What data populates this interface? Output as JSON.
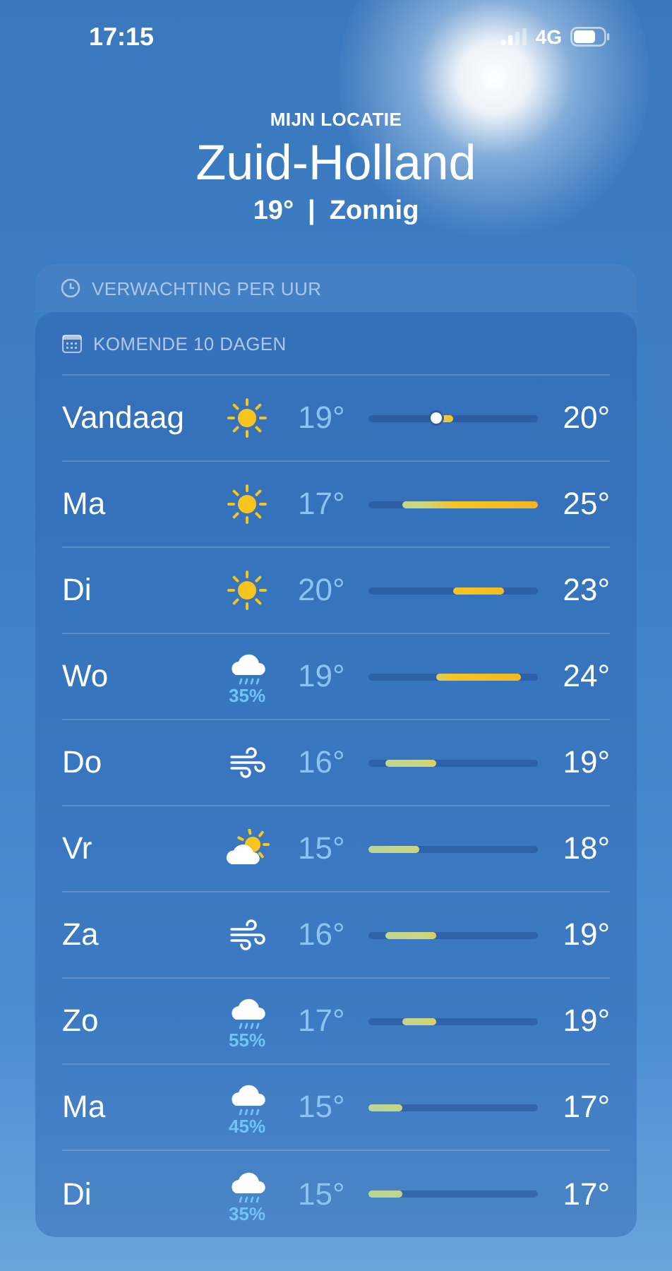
{
  "status_bar": {
    "time": "17:15",
    "network": "4G"
  },
  "header": {
    "subtitle": "MIJN LOCATIE",
    "location": "Zuid-Holland",
    "temperature": "19°",
    "separator": "|",
    "condition": "Zonnig"
  },
  "hourly_forecast": {
    "title": "VERWACHTING PER UUR"
  },
  "daily_forecast": {
    "title": "KOMENDE 10 DAGEN",
    "days": [
      {
        "day": "Vandaag",
        "kind": "sun",
        "low": "19°",
        "high": "20°",
        "current": true
      },
      {
        "day": "Ma",
        "kind": "sun",
        "low": "17°",
        "high": "25°",
        "current": false
      },
      {
        "day": "Di",
        "kind": "sun",
        "low": "20°",
        "high": "23°",
        "current": false
      },
      {
        "day": "Wo",
        "kind": "rain",
        "precipitation": "35%",
        "low": "19°",
        "high": "24°",
        "current": false
      },
      {
        "day": "Do",
        "kind": "wind",
        "low": "16°",
        "high": "19°",
        "current": false
      },
      {
        "day": "Vr",
        "kind": "partly_cloudy",
        "low": "15°",
        "high": "18°",
        "current": false
      },
      {
        "day": "Za",
        "kind": "wind",
        "low": "16°",
        "high": "19°",
        "current": false
      },
      {
        "day": "Zo",
        "kind": "rain",
        "precipitation": "55%",
        "low": "17°",
        "high": "19°",
        "current": false
      },
      {
        "day": "Ma",
        "kind": "rain",
        "precipitation": "45%",
        "low": "15°",
        "high": "17°",
        "current": false
      },
      {
        "day": "Di",
        "kind": "rain",
        "precipitation": "35%",
        "low": "15°",
        "high": "17°",
        "current": false
      }
    ]
  }
}
